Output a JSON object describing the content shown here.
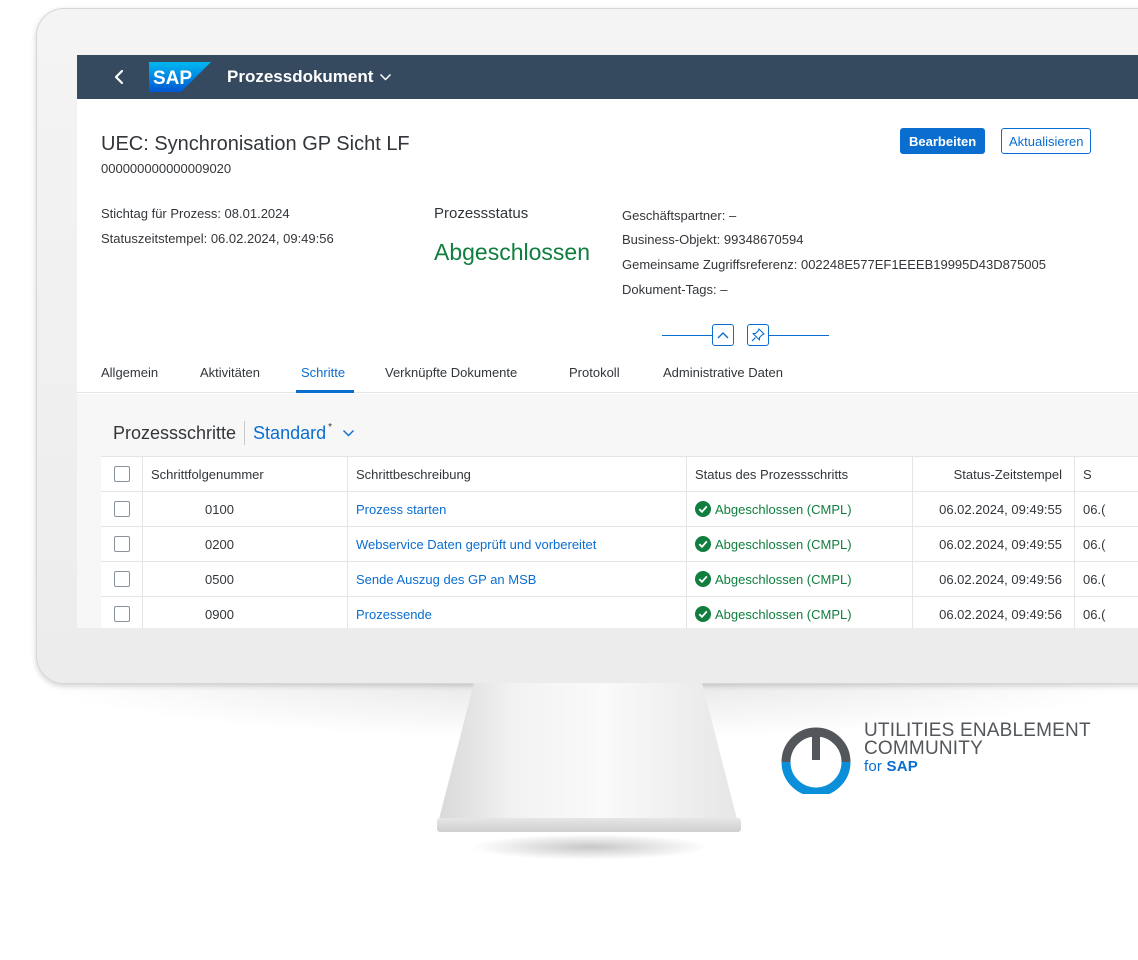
{
  "shell": {
    "back_label": "‹",
    "logo_text": "SAP",
    "app_title": "Prozessdokument"
  },
  "header": {
    "title": "UEC: Synchronisation GP Sicht LF",
    "id": "000000000000009020",
    "edit_label": "Bearbeiten",
    "refresh_label": "Aktualisieren",
    "key_date": "Stichtag für Prozess: 08.01.2024",
    "status_timestamp": "Statuszeitstempel: 06.02.2024, 09:49:56",
    "status_label": "Prozessstatus",
    "status_value": "Abgeschlossen",
    "business_partner_label": "Geschäftspartner:",
    "business_partner_value": "–",
    "business_object_label": "Business-Objekt:",
    "business_object_value": "99348670594",
    "common_ref_label": "Gemeinsame Zugriffsreferenz:",
    "common_ref_value": "002248E577EF1EEEB19995D43D875005",
    "doc_tags_label": "Dokument-Tags:",
    "doc_tags_value": "–"
  },
  "tabs": [
    {
      "label": "Allgemein"
    },
    {
      "label": "Aktivitäten"
    },
    {
      "label": "Schritte"
    },
    {
      "label": "Verknüpfte Dokumente"
    },
    {
      "label": "Protokoll"
    },
    {
      "label": "Administrative Daten"
    }
  ],
  "active_tab": "Schritte",
  "table": {
    "title": "Prozessschritte",
    "variant": "Standard",
    "variant_marker": "*",
    "columns": [
      "Schrittfolgenummer",
      "Schrittbeschreibung",
      "Status des Prozessschritts",
      "Status-Zeitstempel",
      "S"
    ],
    "rows": [
      {
        "seq": "0100",
        "desc": "Prozess starten",
        "status": "Abgeschlossen (CMPL)",
        "timestamp": "06.02.2024, 09:49:55",
        "extra": "06.("
      },
      {
        "seq": "0200",
        "desc": "Webservice Daten geprüft und vorbereitet",
        "status": "Abgeschlossen (CMPL)",
        "timestamp": "06.02.2024, 09:49:55",
        "extra": "06.("
      },
      {
        "seq": "0500",
        "desc": "Sende Auszug des GP an MSB",
        "status": "Abgeschlossen (CMPL)",
        "timestamp": "06.02.2024, 09:49:56",
        "extra": "06.("
      },
      {
        "seq": "0900",
        "desc": "Prozessende",
        "status": "Abgeschlossen (CMPL)",
        "timestamp": "06.02.2024, 09:49:56",
        "extra": "06.("
      }
    ]
  },
  "brand": {
    "line1": "UTILITIES ENABLEMENT",
    "line2": "COMMUNITY",
    "line3_prefix": "for",
    "line3_brand": "SAP"
  },
  "colors": {
    "shell": "#354a5f",
    "accent": "#0a6ed1",
    "success": "#107e3e"
  }
}
